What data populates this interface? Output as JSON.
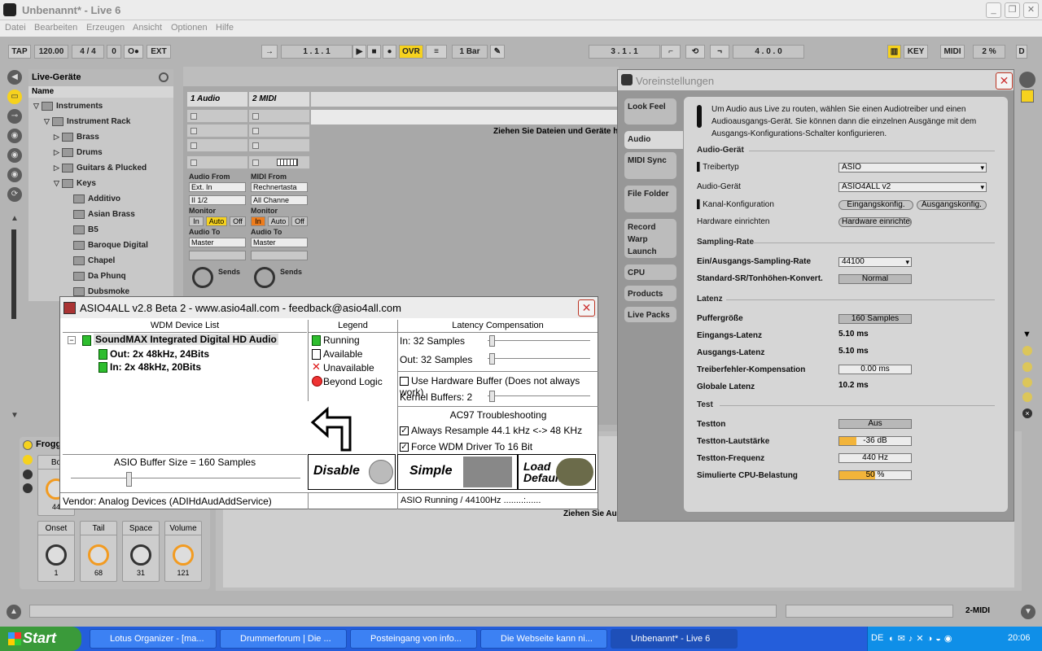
{
  "window": {
    "title": "Unbenannt* - Live 6"
  },
  "menu": [
    "Datei",
    "Bearbeiten",
    "Erzeugen",
    "Ansicht",
    "Optionen",
    "Hilfe"
  ],
  "transport": {
    "tap": "TAP",
    "tempo": "120.00",
    "signature": "4 / 4",
    "zero": "0",
    "metro": "O●",
    "ext": "EXT",
    "position": "1 . 1 . 1",
    "ovr": "OVR",
    "quant": "1 Bar",
    "loop_start": "3 . 1 . 1",
    "loop_len": "4 . 0 . 0",
    "key": "KEY",
    "midi": "MIDI",
    "cpu": "2 %",
    "d": "D"
  },
  "browser": {
    "title": "Live-Geräte",
    "column": "Name",
    "items": [
      "Instruments",
      "Instrument Rack",
      "Brass",
      "Drums",
      "Guitars & Plucked",
      "Keys",
      "Additivo",
      "Asian Brass",
      "B5",
      "Baroque Digital",
      "Chapel",
      "Da Phunq",
      "Dubsmoke"
    ]
  },
  "tracks": [
    {
      "name": "1 Audio",
      "in_label": "Audio From",
      "in_value": "Ext. In",
      "in_chan": "II 1/2",
      "monitor": "Monitor",
      "out_label": "Audio To",
      "out_value": "Master",
      "sends": "Sends"
    },
    {
      "name": "2 MIDI",
      "in_label": "MIDI From",
      "in_value": "Rechnertasta",
      "in_chan": "All Channe",
      "monitor": "Monitor",
      "out_label": "Audio To",
      "out_value": "Master",
      "sends": "Sends"
    }
  ],
  "monitor_opts": [
    "In",
    "Auto",
    "Off"
  ],
  "drop_hint": "Ziehen Sie Dateien und Geräte h",
  "drop_hint2": "Ziehen Sie Au",
  "asio": {
    "title": "ASIO4ALL v2.8 Beta 2 - www.asio4all.com - feedback@asio4all.com",
    "wdm_header": "WDM Device List",
    "device": "SoundMAX Integrated Digital HD Audio",
    "out": "Out:  2x 48kHz, 24Bits",
    "in": "In:    2x 48kHz, 20Bits",
    "legend_header": "Legend",
    "legend": [
      "Running",
      "Available",
      "Unavailable",
      "Beyond Logic"
    ],
    "latency_header": "Latency Compensation",
    "lat_in": "In:   32 Samples",
    "lat_out": "Out: 32 Samples",
    "hw_buffer": "Use Hardware Buffer (Does not always work)",
    "kernel": "Kernel Buffers: 2",
    "ac97_header": "AC97 Troubleshooting",
    "resample": "Always Resample 44.1 kHz <-> 48 KHz",
    "force16": "Force WDM Driver To 16 Bit",
    "buffer_size": "ASIO Buffer Size = 160 Samples",
    "disable": "Disable",
    "simple": "Simple",
    "load_defaults": "Load Defaults",
    "vendor": "Vendor: Analog Devices (ADIHdAudAddService)",
    "status": "ASIO  Running / 44100Hz ........:......"
  },
  "prefs": {
    "title": "Voreinstellungen",
    "tabs": [
      "Look Feel",
      "Audio",
      "MIDI Sync",
      "File Folder",
      "Record Warp Launch",
      "CPU",
      "Products",
      "Live Packs"
    ],
    "info": "Um Audio aus Live zu routen, wählen Sie einen Audiotreiber und einen Audioausgangs-Gerät. Sie können dann die einzelnen Ausgänge mit dem Ausgangs-Konfigurations-Schalter konfigurieren.",
    "sec_device": "Audio-Gerät",
    "driver_type_label": "Treibertyp",
    "driver_type": "ASIO",
    "audio_device_label": "Audio-Gerät",
    "audio_device": "ASIO4ALL v2",
    "channel_config_label": "Kanal-Konfiguration",
    "input_config": "Eingangskonfig.",
    "output_config": "Ausgangskonfig.",
    "hw_setup_label": "Hardware einrichten",
    "hw_setup_btn": "Hardware einrichten",
    "sec_rate": "Sampling-Rate",
    "io_rate_label": "Ein/Ausgangs-Sampling-Rate",
    "io_rate": "44100",
    "sr_conv_label": "Standard-SR/Tonhöhen-Konvert.",
    "sr_conv": "Normal",
    "sec_latency": "Latenz",
    "buffer_label": "Puffergröße",
    "buffer": "160 Samples",
    "in_lat_label": "Eingangs-Latenz",
    "in_lat": "5.10 ms",
    "out_lat_label": "Ausgangs-Latenz",
    "out_lat": "5.10 ms",
    "drv_err_label": "Treiberfehler-Kompensation",
    "drv_err": "0.00 ms",
    "global_lat_label": "Globale Latenz",
    "global_lat": "10.2 ms",
    "sec_test": "Test",
    "tone_label": "Testton",
    "tone": "Aus",
    "tone_vol_label": "Testton-Lautstärke",
    "tone_vol": "-36 dB",
    "tone_freq_label": "Testton-Frequenz",
    "tone_freq": "440 Hz",
    "cpu_sim_label": "Simulierte CPU-Belastung",
    "cpu_sim": "50 %"
  },
  "device": {
    "name": "Frogg",
    "knob_top": "Bo",
    "knob_top_val": "44",
    "knobs": [
      {
        "label": "Onset",
        "value": "1"
      },
      {
        "label": "Tail",
        "value": "68"
      },
      {
        "label": "Space",
        "value": "31"
      },
      {
        "label": "Volume",
        "value": "121"
      }
    ]
  },
  "status_right": "2-MIDI",
  "taskbar": {
    "start": "Start",
    "tasks": [
      "Lotus Organizer - [ma...",
      "Drummerforum | Die ...",
      "Posteingang von info...",
      "Die Webseite kann ni...",
      "Unbenannt* - Live 6"
    ],
    "lang": "DE",
    "clock": "20:06"
  }
}
